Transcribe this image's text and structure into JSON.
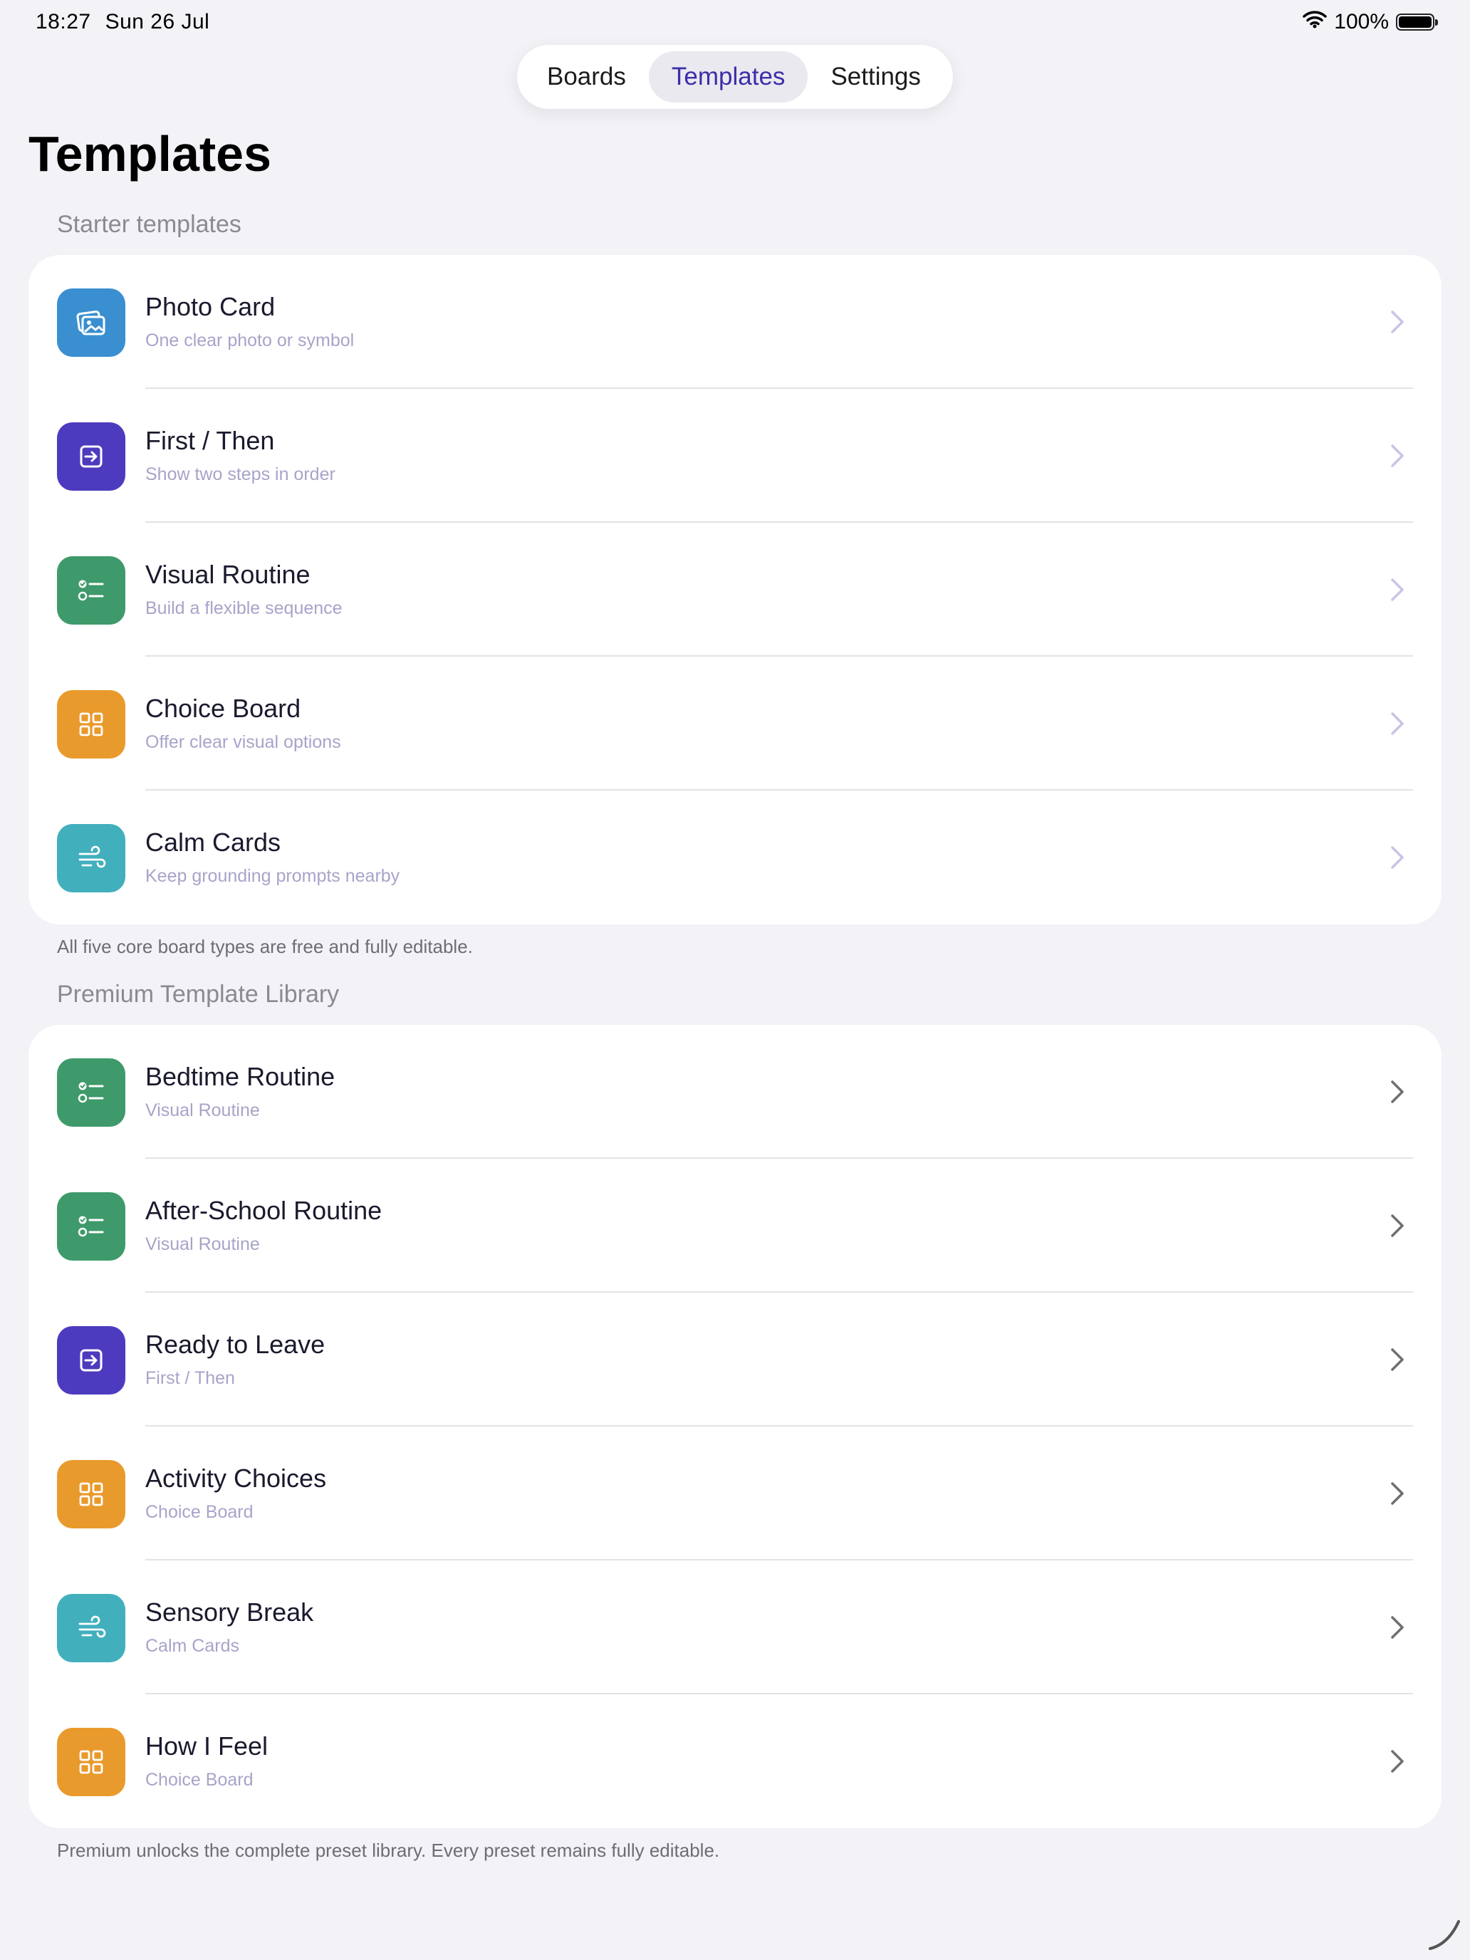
{
  "status": {
    "time": "18:27",
    "date": "Sun 26 Jul",
    "battery": "100%"
  },
  "tabs": [
    {
      "label": "Boards"
    },
    {
      "label": "Templates",
      "selected": true
    },
    {
      "label": "Settings"
    }
  ],
  "page_title": "Templates",
  "starter": {
    "header": "Starter templates",
    "footer": "All five core board types are free and fully editable.",
    "items": [
      {
        "title": "Photo Card",
        "subtitle": "One clear photo or symbol",
        "icon": "photo-icon",
        "color": "#3a8fd0"
      },
      {
        "title": "First / Then",
        "subtitle": "Show two steps in order",
        "icon": "arrow-in-box-icon",
        "color": "#4d3bbf"
      },
      {
        "title": "Visual Routine",
        "subtitle": "Build a flexible sequence",
        "icon": "checklist-icon",
        "color": "#3e9a6a"
      },
      {
        "title": "Choice Board",
        "subtitle": "Offer clear visual options",
        "icon": "grid-icon",
        "color": "#e99a2c"
      },
      {
        "title": "Calm Cards",
        "subtitle": "Keep grounding prompts nearby",
        "icon": "wind-icon",
        "color": "#42afbd"
      }
    ]
  },
  "premium": {
    "header": "Premium Template Library",
    "footer": "Premium unlocks the complete preset library. Every preset remains fully editable.",
    "items": [
      {
        "title": "Bedtime Routine",
        "subtitle": "Visual Routine",
        "icon": "checklist-icon",
        "color": "#3e9a6a"
      },
      {
        "title": "After-School Routine",
        "subtitle": "Visual Routine",
        "icon": "checklist-icon",
        "color": "#3e9a6a"
      },
      {
        "title": "Ready to Leave",
        "subtitle": "First / Then",
        "icon": "arrow-in-box-icon",
        "color": "#4d3bbf"
      },
      {
        "title": "Activity Choices",
        "subtitle": "Choice Board",
        "icon": "grid-icon",
        "color": "#e99a2c"
      },
      {
        "title": "Sensory Break",
        "subtitle": "Calm Cards",
        "icon": "wind-icon",
        "color": "#42afbd"
      },
      {
        "title": "How I Feel",
        "subtitle": "Choice Board",
        "icon": "grid-icon",
        "color": "#e99a2c"
      }
    ]
  },
  "colors": {
    "accent": "#3b2ea8",
    "chevron_starter": "#c7c5e6",
    "chevron_premium": "#6e6e73"
  }
}
